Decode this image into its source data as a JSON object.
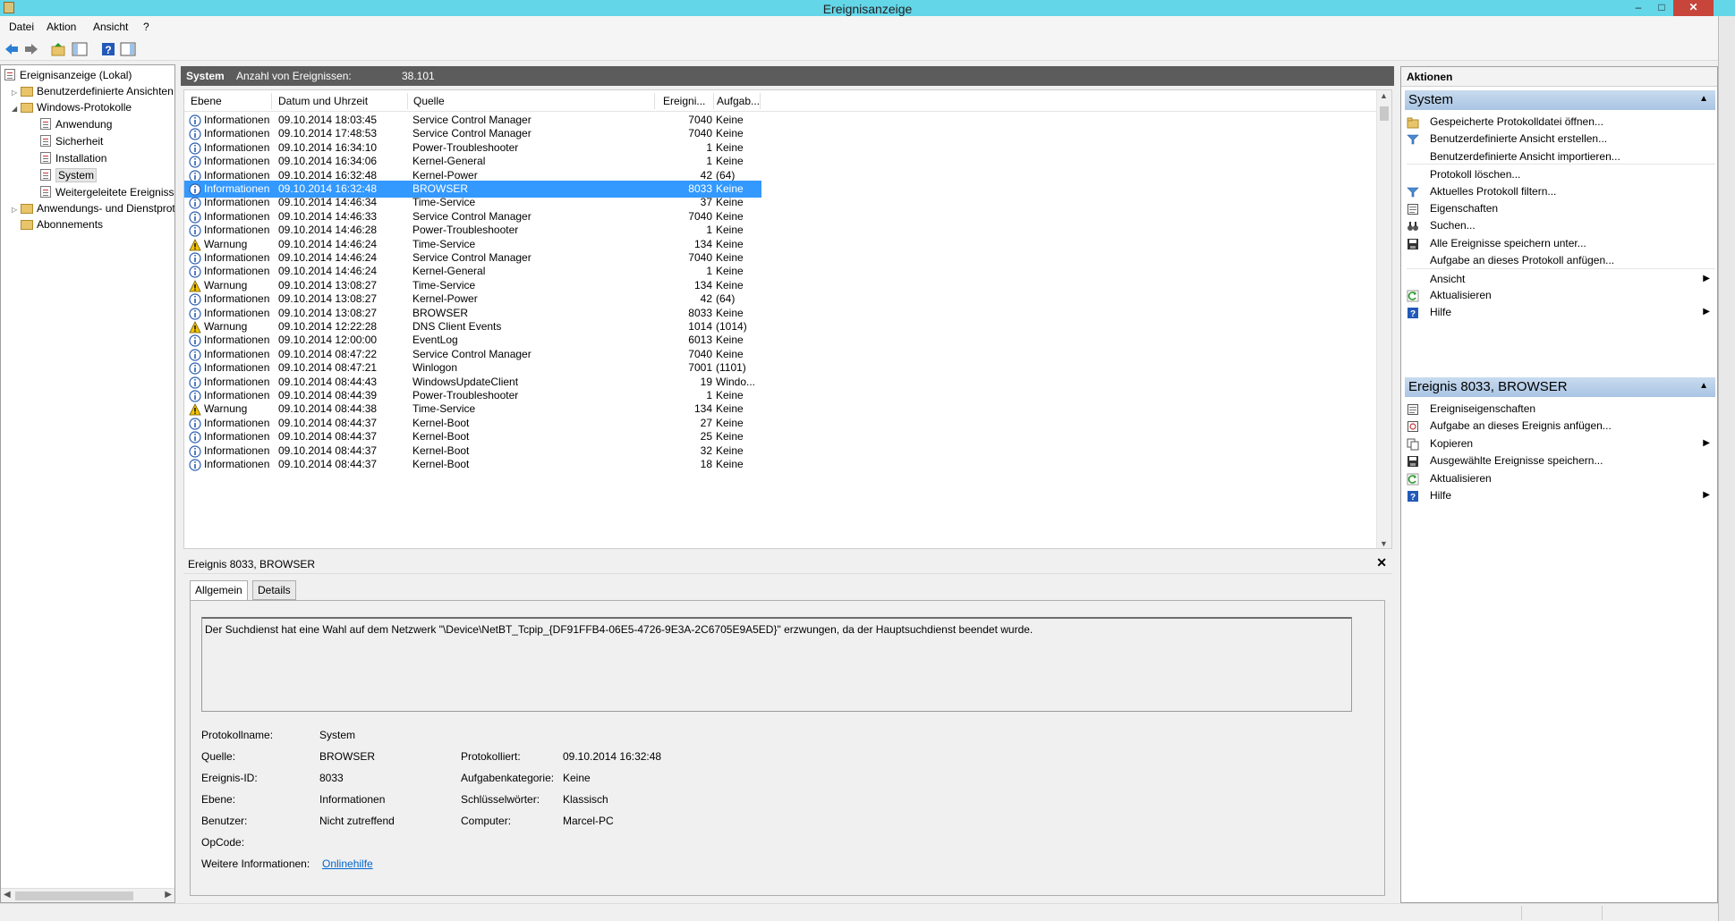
{
  "window": {
    "title": "Ereignisanzeige",
    "minimize_glyph": "–",
    "maximize_glyph": "□",
    "close_glyph": "✕"
  },
  "menu": {
    "items": [
      "Datei",
      "Aktion",
      "Ansicht",
      "?"
    ]
  },
  "toolbar": {
    "icons": [
      "back-arrow-icon",
      "forward-arrow-icon",
      "folder-up-icon",
      "console-tree-icon",
      "help-icon",
      "action-pane-icon"
    ]
  },
  "tree": {
    "root": "Ereignisanzeige (Lokal)",
    "custom_views": "Benutzerdefinierte Ansichten",
    "windows_logs": "Windows-Protokolle",
    "logs": [
      "Anwendung",
      "Sicherheit",
      "Installation",
      "System",
      "Weitergeleitete Ereignisse"
    ],
    "app_service_logs": "Anwendungs- und Dienstprotokolle",
    "subscriptions": "Abonnements",
    "selected": "System"
  },
  "center": {
    "log_name": "System",
    "count_label": "Anzahl von Ereignissen:",
    "count_value": "38.101"
  },
  "columns": [
    "Ebene",
    "Datum und Uhrzeit",
    "Quelle",
    "Ereigni...",
    "Aufgab..."
  ],
  "events": [
    {
      "level": "Informationen",
      "datetime": "09.10.2014 18:03:45",
      "source": "Service Control Manager",
      "id": "7040",
      "task": "Keine"
    },
    {
      "level": "Informationen",
      "datetime": "09.10.2014 17:48:53",
      "source": "Service Control Manager",
      "id": "7040",
      "task": "Keine"
    },
    {
      "level": "Informationen",
      "datetime": "09.10.2014 16:34:10",
      "source": "Power-Troubleshooter",
      "id": "1",
      "task": "Keine"
    },
    {
      "level": "Informationen",
      "datetime": "09.10.2014 16:34:06",
      "source": "Kernel-General",
      "id": "1",
      "task": "Keine"
    },
    {
      "level": "Informationen",
      "datetime": "09.10.2014 16:32:48",
      "source": "Kernel-Power",
      "id": "42",
      "task": "(64)"
    },
    {
      "level": "Informationen",
      "datetime": "09.10.2014 16:32:48",
      "source": "BROWSER",
      "id": "8033",
      "task": "Keine",
      "selected": true
    },
    {
      "level": "Informationen",
      "datetime": "09.10.2014 14:46:34",
      "source": "Time-Service",
      "id": "37",
      "task": "Keine"
    },
    {
      "level": "Informationen",
      "datetime": "09.10.2014 14:46:33",
      "source": "Service Control Manager",
      "id": "7040",
      "task": "Keine"
    },
    {
      "level": "Informationen",
      "datetime": "09.10.2014 14:46:28",
      "source": "Power-Troubleshooter",
      "id": "1",
      "task": "Keine"
    },
    {
      "level": "Warnung",
      "datetime": "09.10.2014 14:46:24",
      "source": "Time-Service",
      "id": "134",
      "task": "Keine"
    },
    {
      "level": "Informationen",
      "datetime": "09.10.2014 14:46:24",
      "source": "Service Control Manager",
      "id": "7040",
      "task": "Keine"
    },
    {
      "level": "Informationen",
      "datetime": "09.10.2014 14:46:24",
      "source": "Kernel-General",
      "id": "1",
      "task": "Keine"
    },
    {
      "level": "Warnung",
      "datetime": "09.10.2014 13:08:27",
      "source": "Time-Service",
      "id": "134",
      "task": "Keine"
    },
    {
      "level": "Informationen",
      "datetime": "09.10.2014 13:08:27",
      "source": "Kernel-Power",
      "id": "42",
      "task": "(64)"
    },
    {
      "level": "Informationen",
      "datetime": "09.10.2014 13:08:27",
      "source": "BROWSER",
      "id": "8033",
      "task": "Keine"
    },
    {
      "level": "Warnung",
      "datetime": "09.10.2014 12:22:28",
      "source": "DNS Client Events",
      "id": "1014",
      "task": "(1014)"
    },
    {
      "level": "Informationen",
      "datetime": "09.10.2014 12:00:00",
      "source": "EventLog",
      "id": "6013",
      "task": "Keine"
    },
    {
      "level": "Informationen",
      "datetime": "09.10.2014 08:47:22",
      "source": "Service Control Manager",
      "id": "7040",
      "task": "Keine"
    },
    {
      "level": "Informationen",
      "datetime": "09.10.2014 08:47:21",
      "source": "Winlogon",
      "id": "7001",
      "task": "(1101)"
    },
    {
      "level": "Informationen",
      "datetime": "09.10.2014 08:44:43",
      "source": "WindowsUpdateClient",
      "id": "19",
      "task": "Windo..."
    },
    {
      "level": "Informationen",
      "datetime": "09.10.2014 08:44:39",
      "source": "Power-Troubleshooter",
      "id": "1",
      "task": "Keine"
    },
    {
      "level": "Warnung",
      "datetime": "09.10.2014 08:44:38",
      "source": "Time-Service",
      "id": "134",
      "task": "Keine"
    },
    {
      "level": "Informationen",
      "datetime": "09.10.2014 08:44:37",
      "source": "Kernel-Boot",
      "id": "27",
      "task": "Keine"
    },
    {
      "level": "Informationen",
      "datetime": "09.10.2014 08:44:37",
      "source": "Kernel-Boot",
      "id": "25",
      "task": "Keine"
    },
    {
      "level": "Informationen",
      "datetime": "09.10.2014 08:44:37",
      "source": "Kernel-Boot",
      "id": "32",
      "task": "Keine"
    },
    {
      "level": "Informationen",
      "datetime": "09.10.2014 08:44:37",
      "source": "Kernel-Boot",
      "id": "18",
      "task": "Keine"
    }
  ],
  "detail": {
    "title": "Ereignis 8033, BROWSER",
    "close_glyph": "✕",
    "tabs": [
      "Allgemein",
      "Details"
    ],
    "description": "Der Suchdienst hat eine Wahl auf dem Netzwerk \"\\Device\\NetBT_Tcpip_{DF91FFB4-06E5-4726-9E3A-2C6705E9A5ED}\" erzwungen, da der Hauptsuchdienst beendet wurde.",
    "labels": {
      "protokollname": "Protokollname:",
      "quelle": "Quelle:",
      "ereignis_id": "Ereignis-ID:",
      "ebene": "Ebene:",
      "benutzer": "Benutzer:",
      "opcode": "OpCode:",
      "weitere": "Weitere Informationen:",
      "protokolliert": "Protokolliert:",
      "aufgabenkategorie": "Aufgabenkategorie:",
      "schluesselwoerter": "Schlüsselwörter:",
      "computer": "Computer:"
    },
    "values": {
      "protokollname": "System",
      "quelle": "BROWSER",
      "ereignis_id": "8033",
      "ebene": "Informationen",
      "benutzer": "Nicht zutreffend",
      "protokolliert": "09.10.2014 16:32:48",
      "aufgabenkategorie": "Keine",
      "schluesselwoerter": "Klassisch",
      "computer": "Marcel-PC",
      "onlinehilfe": "Onlinehilfe"
    }
  },
  "actions": {
    "header": "Aktionen",
    "system_section": "System",
    "system_items": [
      {
        "label": "Gespeicherte Protokolldatei öffnen...",
        "icon": "open-folder-icon"
      },
      {
        "label": "Benutzerdefinierte Ansicht erstellen...",
        "icon": "filter-icon"
      },
      {
        "label": "Benutzerdefinierte Ansicht importieren...",
        "icon": ""
      },
      {
        "label": "Protokoll löschen...",
        "icon": ""
      },
      {
        "label": "Aktuelles Protokoll filtern...",
        "icon": "filter-icon"
      },
      {
        "label": "Eigenschaften",
        "icon": "properties-icon"
      },
      {
        "label": "Suchen...",
        "icon": "binoculars-icon"
      },
      {
        "label": "Alle Ereignisse speichern unter...",
        "icon": "save-icon"
      },
      {
        "label": "Aufgabe an dieses Protokoll anfügen...",
        "icon": ""
      },
      {
        "label": "Ansicht",
        "icon": "",
        "submenu": true
      },
      {
        "label": "Aktualisieren",
        "icon": "refresh-icon"
      },
      {
        "label": "Hilfe",
        "icon": "help-icon",
        "submenu": true
      }
    ],
    "event_section": "Ereignis 8033, BROWSER",
    "event_items": [
      {
        "label": "Ereigniseigenschaften",
        "icon": "properties-icon"
      },
      {
        "label": "Aufgabe an dieses Ereignis anfügen...",
        "icon": "task-icon"
      },
      {
        "label": "Kopieren",
        "icon": "copy-icon",
        "submenu": true
      },
      {
        "label": "Ausgewählte Ereignisse speichern...",
        "icon": "save-icon"
      },
      {
        "label": "Aktualisieren",
        "icon": "refresh-icon"
      },
      {
        "label": "Hilfe",
        "icon": "help-icon",
        "submenu": true
      }
    ]
  }
}
